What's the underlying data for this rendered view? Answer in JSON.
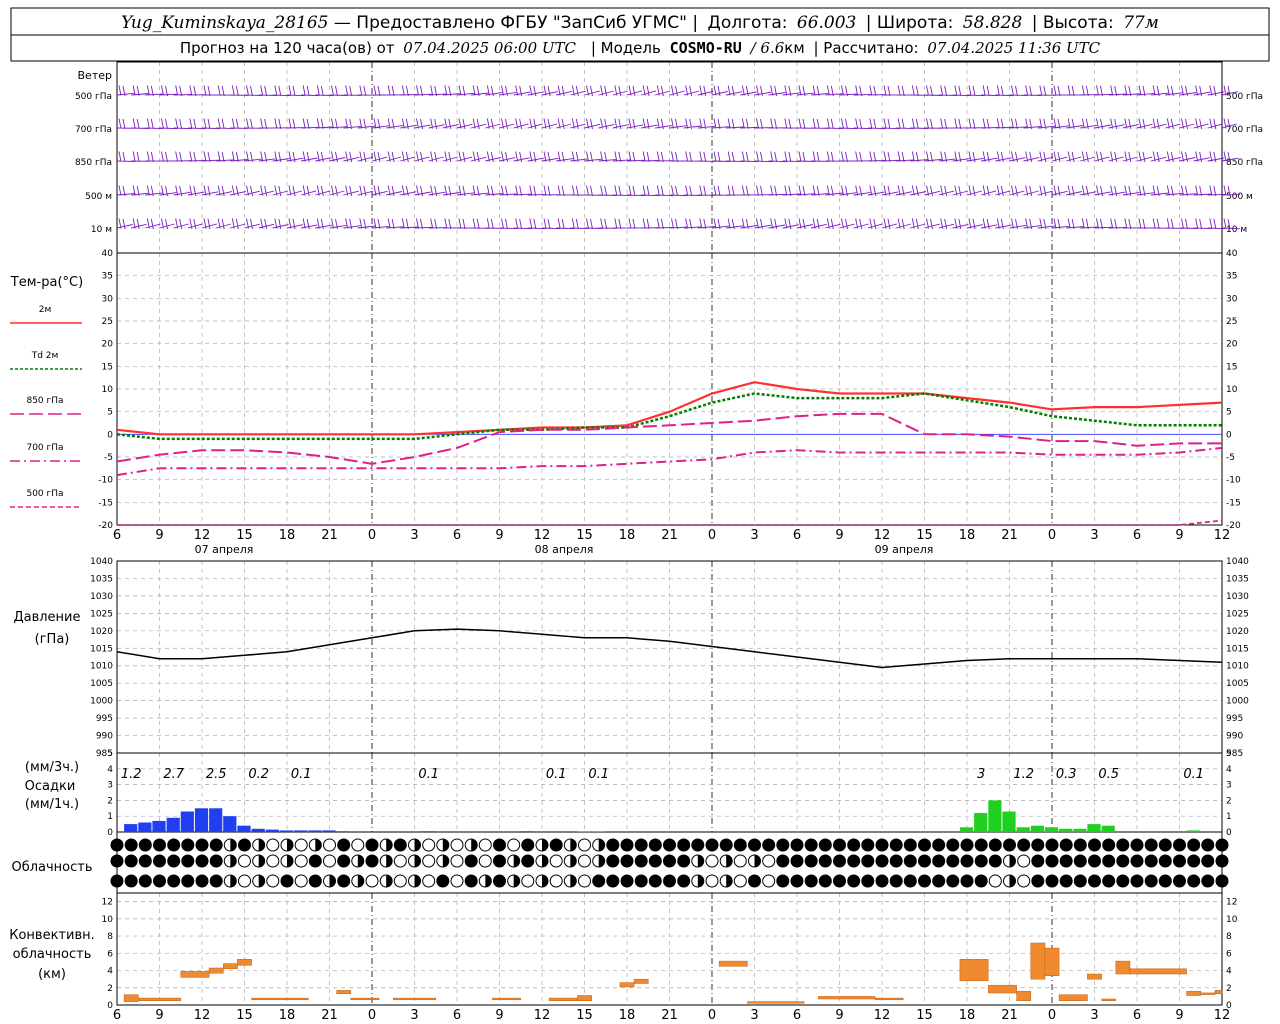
{
  "header": {
    "station": "Yug_Kuminskaya_28165",
    "provider": " — Предоставлено ФГБУ \"ЗапСиб УГМС\" |",
    "lon_label": "Долгота:",
    "lon_value": "66.003",
    "lat_label": "| Широта:",
    "lat_value": "58.828",
    "alt_label": "| Высота:",
    "alt_value": "77м",
    "forecast_prefix": "Прогноз на 120 часа(ов) от",
    "forecast_date": "07.04.2025 06:00 UTC",
    "model_prefix": "| Модель",
    "model_name": "COSMO-RU",
    "model_res": "/ 6.6",
    "model_res_unit": "км",
    "calc_prefix": "| Рассчитано:",
    "calc_date": "07.04.2025 11:36 UTC"
  },
  "wind_panel": {
    "title": "Ветер",
    "levels": [
      "500 гПа",
      "700 гПа",
      "850 гПа",
      "500 м",
      "10  м"
    ]
  },
  "temp_panel": {
    "title": "Тем-ра(°C)",
    "legend": [
      {
        "label": "2м",
        "color": "#ff3030",
        "dash": ""
      },
      {
        "label": "Td  2м",
        "color": "#008000",
        "dash": "3,2"
      },
      {
        "label": "850 гПа",
        "color": "#e0208a",
        "dash": "14,5"
      },
      {
        "label": "700 гПа",
        "color": "#e0208a",
        "dash": "10,4,2,4"
      },
      {
        "label": "500 гПа",
        "color": "#e0208a",
        "dash": "5,3"
      }
    ],
    "yticks": [
      "40",
      "35",
      "30",
      "25",
      "20",
      "15",
      "10",
      "5",
      "0",
      "-5",
      "-10",
      "-15",
      "-20"
    ],
    "day_labels": [
      "07 апреля",
      "08 апреля",
      "09 апреля"
    ]
  },
  "pressure_panel": {
    "title": "Давление",
    "unit": "(гПа)",
    "yticks": [
      "1040",
      "1035",
      "1030",
      "1025",
      "1020",
      "1015",
      "1010",
      "1005",
      "1000",
      "995",
      "990",
      "985"
    ]
  },
  "precip_panel": {
    "title": "Осадки",
    "unit_3h": "(мм/3ч.)",
    "unit_1h": "(мм/1ч.)",
    "yticks": [
      "5",
      "4",
      "3",
      "2",
      "1",
      "0"
    ],
    "sums": [
      {
        "h": 1,
        "v": "1.2"
      },
      {
        "h": 4,
        "v": "2.7"
      },
      {
        "h": 7,
        "v": "2.5"
      },
      {
        "h": 10,
        "v": "0.2"
      },
      {
        "h": 13,
        "v": "0.1"
      },
      {
        "h": 22,
        "v": "0.1"
      },
      {
        "h": 31,
        "v": "0.1"
      },
      {
        "h": 34,
        "v": "0.1"
      },
      {
        "h": 61,
        "v": "3"
      },
      {
        "h": 64,
        "v": "1.2"
      },
      {
        "h": 67,
        "v": "0.3"
      },
      {
        "h": 70,
        "v": "0.5"
      },
      {
        "h": 76,
        "v": "0.1"
      }
    ]
  },
  "cloud_panel": {
    "title": "Облачность"
  },
  "conv_panel": {
    "title": "Конвективн.",
    "title2": "облачность",
    "unit": "(км)",
    "yticks": [
      "12",
      "10",
      "8",
      "6",
      "4",
      "2",
      "0"
    ]
  },
  "time_axis": {
    "labels": [
      "6",
      "9",
      "12",
      "15",
      "18",
      "21",
      "0",
      "3",
      "6",
      "9",
      "12",
      "15",
      "18",
      "21",
      "0",
      "3",
      "6",
      "9",
      "12",
      "15",
      "18",
      "21",
      "0",
      "3",
      "6",
      "9",
      "12"
    ]
  },
  "colors": {
    "wind": "#7a1fc0",
    "t2m": "#ff3030",
    "td2m": "#008000",
    "pink": "#e0208a",
    "zero": "#3333ff",
    "precip_blue": "#1f3ff0",
    "precip_green": "#20d020",
    "conv": "#f08a30"
  },
  "chart_data": {
    "type": "line",
    "x_unit": "hours since 07.04.2025 06:00 UTC",
    "x": [
      0,
      3,
      6,
      9,
      12,
      15,
      18,
      21,
      24,
      27,
      30,
      33,
      36,
      39,
      42,
      45,
      48,
      51,
      54,
      57,
      60,
      63,
      66,
      69,
      72,
      75,
      78
    ],
    "series": [
      {
        "name": "2м",
        "values": [
          1,
          0,
          0,
          0,
          0,
          0,
          0,
          0,
          0.5,
          1,
          1.5,
          1.5,
          2,
          5,
          9,
          11.5,
          10,
          9,
          9,
          9,
          8,
          7,
          5.5,
          6,
          6,
          6.5,
          7
        ]
      },
      {
        "name": "Td  2м",
        "values": [
          0,
          -1,
          -1,
          -1,
          -1,
          -1,
          -1,
          -1,
          0,
          1,
          1,
          1.5,
          1.5,
          4,
          7,
          9,
          8,
          8,
          8,
          9,
          7.5,
          6,
          4,
          3,
          2,
          2,
          2
        ]
      },
      {
        "name": "850 гПа",
        "values": [
          -6,
          -4.5,
          -3.5,
          -3.5,
          -4,
          -5,
          -6.5,
          -5,
          -3,
          0.5,
          1,
          1,
          1.5,
          2,
          2.5,
          3,
          4,
          4.5,
          4.5,
          0,
          0,
          -0.5,
          -1.5,
          -1.5,
          -2.5,
          -2,
          -2
        ]
      },
      {
        "name": "700 гПа",
        "values": [
          -9,
          -7.5,
          -7.5,
          -7.5,
          -7.5,
          -7.5,
          -7.5,
          -7.5,
          -7.5,
          -7.5,
          -7,
          -7,
          -6.5,
          -6,
          -5.5,
          -4,
          -3.5,
          -4,
          -4,
          -4,
          -4,
          -4,
          -4.5,
          -4.5,
          -4.5,
          -4,
          -3
        ]
      },
      {
        "name": "500 гПа",
        "values": [
          -20,
          -20,
          -20,
          -20,
          -20,
          -20,
          -20,
          -20,
          -20,
          -20,
          -20,
          -20,
          -20,
          -20,
          -20,
          -20,
          -20,
          -20,
          -20,
          -20,
          -20,
          -20,
          -20,
          -20,
          -20,
          -20,
          -19
        ]
      },
      {
        "name": "Давление",
        "values": [
          1014,
          1012,
          1012,
          1013,
          1014,
          1016,
          1018,
          1020,
          1020.5,
          1020,
          1019,
          1018,
          1018,
          1017,
          1015.5,
          1014,
          1012.5,
          1011,
          1009.5,
          1010.5,
          1011.5,
          1012,
          1012,
          1012,
          1012,
          1011.5,
          1011
        ]
      }
    ],
    "precip_hourly": [
      {
        "h": 1,
        "v": 0.5,
        "c": "blue"
      },
      {
        "h": 2,
        "v": 0.6,
        "c": "blue"
      },
      {
        "h": 3,
        "v": 0.7,
        "c": "blue"
      },
      {
        "h": 4,
        "v": 0.9,
        "c": "blue"
      },
      {
        "h": 5,
        "v": 1.3,
        "c": "blue"
      },
      {
        "h": 6,
        "v": 1.5,
        "c": "blue"
      },
      {
        "h": 7,
        "v": 1.5,
        "c": "blue"
      },
      {
        "h": 8,
        "v": 1.0,
        "c": "blue"
      },
      {
        "h": 9,
        "v": 0.4,
        "c": "blue"
      },
      {
        "h": 10,
        "v": 0.2,
        "c": "blue"
      },
      {
        "h": 11,
        "v": 0.15,
        "c": "blue"
      },
      {
        "h": 12,
        "v": 0.1,
        "c": "blue"
      },
      {
        "h": 13,
        "v": 0.1,
        "c": "blue"
      },
      {
        "h": 14,
        "v": 0.1,
        "c": "blue"
      },
      {
        "h": 15,
        "v": 0.1,
        "c": "blue"
      },
      {
        "h": 16,
        "v": 0.05,
        "c": "blue"
      },
      {
        "h": 22,
        "v": 0.05,
        "c": "blue"
      },
      {
        "h": 29,
        "v": 0.05,
        "c": "blue"
      },
      {
        "h": 33,
        "v": 0.05,
        "c": "green"
      },
      {
        "h": 34,
        "v": 0.05,
        "c": "green"
      },
      {
        "h": 60,
        "v": 0.3,
        "c": "green"
      },
      {
        "h": 61,
        "v": 1.2,
        "c": "green"
      },
      {
        "h": 62,
        "v": 2.0,
        "c": "green"
      },
      {
        "h": 63,
        "v": 1.3,
        "c": "green"
      },
      {
        "h": 64,
        "v": 0.3,
        "c": "green"
      },
      {
        "h": 65,
        "v": 0.4,
        "c": "green"
      },
      {
        "h": 66,
        "v": 0.3,
        "c": "green"
      },
      {
        "h": 67,
        "v": 0.2,
        "c": "green"
      },
      {
        "h": 68,
        "v": 0.2,
        "c": "green"
      },
      {
        "h": 69,
        "v": 0.5,
        "c": "green"
      },
      {
        "h": 70,
        "v": 0.4,
        "c": "green"
      },
      {
        "h": 76,
        "v": 0.1,
        "c": "green"
      }
    ],
    "conv_cloud": [
      {
        "h0": 0.5,
        "h1": 1.5,
        "bot": 0.4,
        "top": 1.2
      },
      {
        "h0": 1.5,
        "h1": 4.5,
        "bot": 0.5,
        "top": 0.8
      },
      {
        "h0": 4.5,
        "h1": 6.5,
        "bot": 3.2,
        "top": 3.9
      },
      {
        "h0": 6.5,
        "h1": 7.5,
        "bot": 3.7,
        "top": 4.3
      },
      {
        "h0": 7.5,
        "h1": 8.5,
        "bot": 4.2,
        "top": 4.8
      },
      {
        "h0": 8.5,
        "h1": 9.5,
        "bot": 4.6,
        "top": 5.3
      },
      {
        "h0": 9.5,
        "h1": 13.5,
        "bot": 0.6,
        "top": 0.8
      },
      {
        "h0": 15.5,
        "h1": 16.5,
        "bot": 1.3,
        "top": 1.7
      },
      {
        "h0": 16.5,
        "h1": 18.5,
        "bot": 0.6,
        "top": 0.8
      },
      {
        "h0": 19.5,
        "h1": 22.5,
        "bot": 0.6,
        "top": 0.8
      },
      {
        "h0": 26.5,
        "h1": 28.5,
        "bot": 0.6,
        "top": 0.8
      },
      {
        "h0": 30.5,
        "h1": 32.5,
        "bot": 0.5,
        "top": 0.8
      },
      {
        "h0": 32.5,
        "h1": 33.5,
        "bot": 0.5,
        "top": 1.1
      },
      {
        "h0": 35.5,
        "h1": 36.5,
        "bot": 2.1,
        "top": 2.6
      },
      {
        "h0": 36.5,
        "h1": 37.5,
        "bot": 2.5,
        "top": 3.0
      },
      {
        "h0": 42.5,
        "h1": 44.5,
        "bot": 4.5,
        "top": 5.1
      },
      {
        "h0": 44.5,
        "h1": 48.5,
        "bot": 0.2,
        "top": 0.4
      },
      {
        "h0": 49.5,
        "h1": 53.5,
        "bot": 0.7,
        "top": 1.0
      },
      {
        "h0": 53.5,
        "h1": 55.5,
        "bot": 0.6,
        "top": 0.8
      },
      {
        "h0": 59.5,
        "h1": 61.5,
        "bot": 2.8,
        "top": 5.3
      },
      {
        "h0": 61.5,
        "h1": 63.5,
        "bot": 1.4,
        "top": 2.3
      },
      {
        "h0": 63.5,
        "h1": 64.5,
        "bot": 0.5,
        "top": 1.6
      },
      {
        "h0": 64.5,
        "h1": 65.5,
        "bot": 3.0,
        "top": 7.2
      },
      {
        "h0": 65.5,
        "h1": 66.5,
        "bot": 3.4,
        "top": 6.6
      },
      {
        "h0": 66.5,
        "h1": 68.5,
        "bot": 0.5,
        "top": 1.2
      },
      {
        "h0": 68.5,
        "h1": 69.5,
        "bot": 3.0,
        "top": 3.6
      },
      {
        "h0": 69.5,
        "h1": 70.5,
        "bot": 0.5,
        "top": 0.7
      },
      {
        "h0": 70.5,
        "h1": 71.5,
        "bot": 3.6,
        "top": 5.1
      },
      {
        "h0": 71.5,
        "h1": 75.5,
        "bot": 3.6,
        "top": 4.2
      },
      {
        "h0": 75.5,
        "h1": 76.5,
        "bot": 1.1,
        "top": 1.6
      },
      {
        "h0": 76.5,
        "h1": 77.5,
        "bot": 1.2,
        "top": 1.4
      },
      {
        "h0": 77.5,
        "h1": 78,
        "bot": 1.3,
        "top": 1.7
      }
    ],
    "ylim_temp": [
      -20,
      40
    ],
    "ylim_pressure": [
      985,
      1040
    ],
    "ylim_precip": [
      0,
      5
    ],
    "ylim_conv": [
      0,
      13
    ],
    "grid": true
  }
}
